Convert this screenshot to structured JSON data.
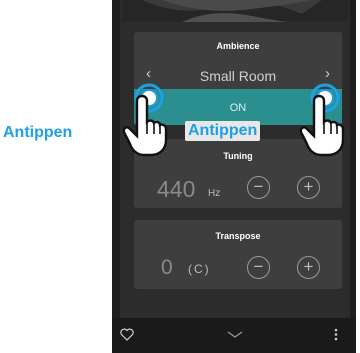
{
  "ambience": {
    "title": "Ambience",
    "value": "Small Room",
    "prev_icon": "chevron-left",
    "next_icon": "chevron-right",
    "toggle_label": "ON"
  },
  "tuning": {
    "title": "Tuning",
    "value": "440",
    "unit": "Hz",
    "minus": "−",
    "plus": "+"
  },
  "transpose": {
    "title": "Transpose",
    "value": "0",
    "note": "(C)",
    "minus": "−",
    "plus": "+"
  },
  "bottom_bar": {
    "favorite_icon": "heart-outline",
    "collapse_icon": "chevron-down",
    "menu_icon": "vertical-ellipsis"
  },
  "annotations": {
    "left_label": "Antippen",
    "right_label": "Antippen"
  },
  "colors": {
    "accent_teal": "#2b8f8f",
    "tap_blue": "#1e9fe6",
    "card_bg": "#3e3e3e"
  }
}
